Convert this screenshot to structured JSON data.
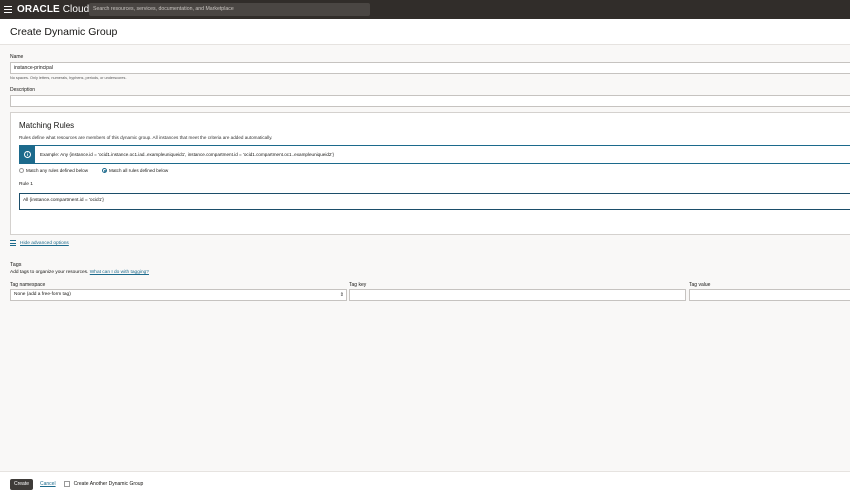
{
  "topbar": {
    "brand_bold": "ORACLE",
    "brand_rest": " Cloud",
    "search_placeholder": "Search resources, services, documentation, and Marketplace"
  },
  "page": {
    "title": "Create Dynamic Group"
  },
  "form": {
    "name_label": "Name",
    "name_value": "instance-principal",
    "name_hint": "No spaces. Only letters, numerals, hyphens, periods, or underscores.",
    "description_label": "Description",
    "description_value": ""
  },
  "matching_rules": {
    "title": "Matching Rules",
    "description": "Rules define what resources are members of this dynamic group. All instances that meet the criteria are added automatically.",
    "example": "Example: Any {instance.id = 'ocid1.instance.oc1.iad..exampleuniqueid1', instance.compartment.id = 'ocid1.compartment.oc1..exampleuniqueid2'}",
    "radio_any": "Match any rules defined below",
    "radio_all": "Match all rules defined below",
    "selected_radio": "all",
    "rule_label": "Rule 1",
    "rule_value": "All {instance.compartment.id = 'ocid1'}"
  },
  "advanced": {
    "link": "Hide advanced options"
  },
  "tags": {
    "title": "Tags",
    "description": "Add tags to organize your resources.",
    "help_link": "What can I do with tagging?",
    "namespace_label": "Tag namespace",
    "namespace_value": "None (add a free-form tag)",
    "key_label": "Tag key",
    "key_value": "",
    "value_label": "Tag value",
    "value_value": ""
  },
  "footer": {
    "create_label": "Create",
    "cancel_label": "Cancel",
    "another_label": "Create Another Dynamic Group"
  },
  "colors": {
    "topbar": "#312d2a",
    "accent": "#1c6a8c",
    "primary_button": "#3e3b38"
  }
}
